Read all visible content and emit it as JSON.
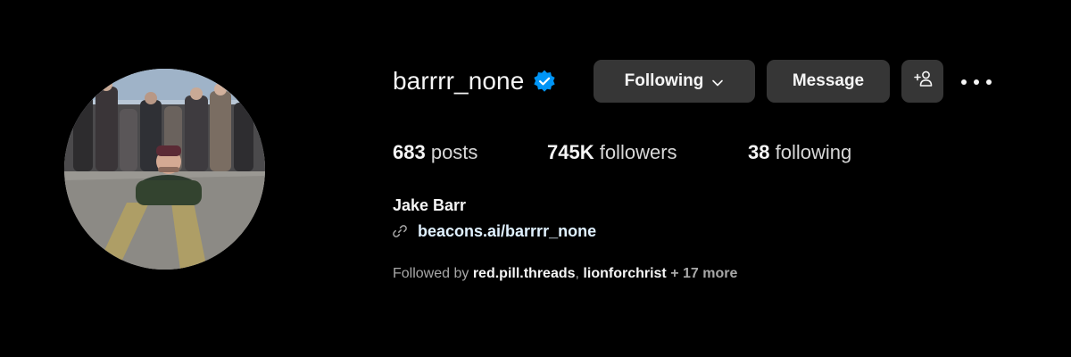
{
  "profile": {
    "username": "barrrr_none",
    "verified": true,
    "full_name": "Jake Barr",
    "link": "beacons.ai/barrrr_none",
    "avatar_icon": "profile-photo"
  },
  "actions": {
    "following_label": "Following",
    "message_label": "Message",
    "suggest_icon": "add-person-icon",
    "more_icon": "more-options-icon"
  },
  "stats": {
    "posts_count": "683",
    "posts_label": " posts",
    "followers_count": "745K",
    "followers_label": " followers",
    "following_count": "38",
    "following_label": " following"
  },
  "followed_by": {
    "prefix": "Followed by ",
    "users": [
      "red.pill.threads",
      "lionforchrist"
    ],
    "separator": ", ",
    "more": " + 17 more"
  },
  "colors": {
    "background": "#000000",
    "button": "#363636",
    "verified": "#0095f6",
    "link": "#e0f1ff",
    "secondary_text": "#a8a8a8"
  }
}
